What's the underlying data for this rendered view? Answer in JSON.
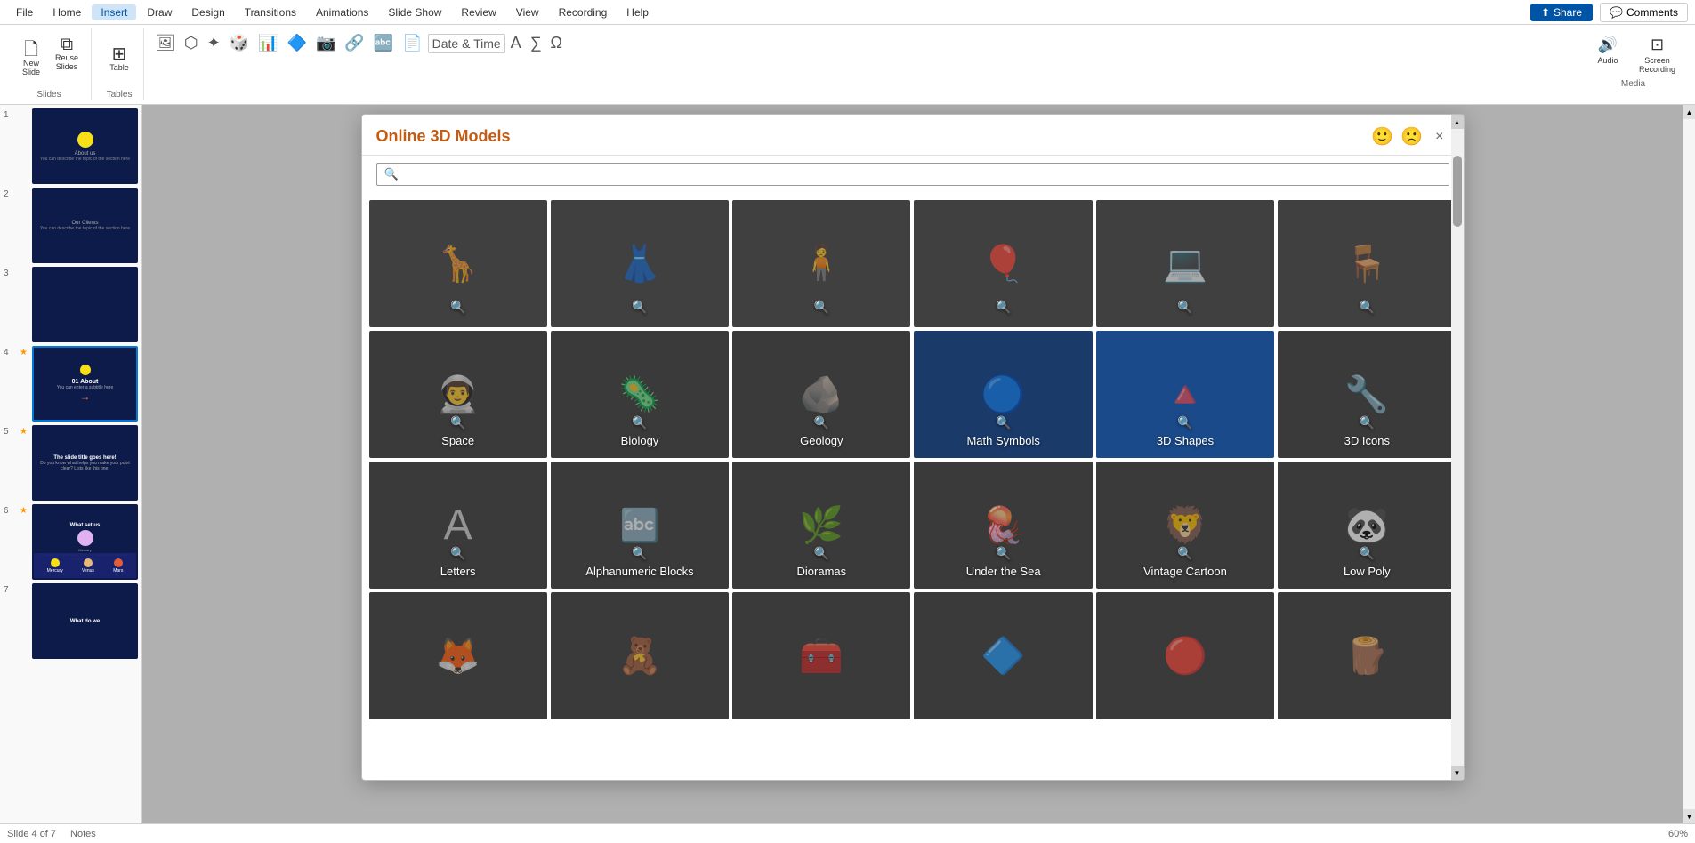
{
  "menubar": {
    "items": [
      "File",
      "Home",
      "Insert",
      "Draw",
      "Design",
      "Transitions",
      "Animations",
      "Slide Show",
      "Review",
      "View",
      "Recording",
      "Help"
    ],
    "active": "Insert",
    "share_label": "Share",
    "comments_label": "Comments"
  },
  "ribbon": {
    "groups": [
      {
        "name": "Slides",
        "items": [
          {
            "label": "New\nSlide",
            "icon": "🗋"
          },
          {
            "label": "Reuse\nSlides",
            "icon": "⧉"
          }
        ]
      },
      {
        "name": "Tables",
        "items": [
          {
            "label": "Table",
            "icon": "⊞"
          }
        ]
      }
    ],
    "media": {
      "label": "Media",
      "items": [
        {
          "label": "Audio",
          "icon": "🔊"
        },
        {
          "label": "Screen\nRecording",
          "icon": "⊡"
        }
      ]
    },
    "date_time_label": "Date & Time"
  },
  "slides": [
    {
      "num": "1",
      "star": false,
      "type": "title",
      "label": "About us"
    },
    {
      "num": "2",
      "star": false,
      "type": "clients",
      "label": "Our Clients"
    },
    {
      "num": "3",
      "star": false,
      "type": "blank"
    },
    {
      "num": "4",
      "star": true,
      "type": "about",
      "label": "01 About",
      "selected": true
    },
    {
      "num": "5",
      "star": true,
      "type": "slide",
      "label": "The slide title goes here!"
    },
    {
      "num": "6",
      "star": true,
      "type": "what",
      "label": "What set us"
    },
    {
      "num": "7",
      "star": false,
      "type": "what2",
      "label": "What do we"
    }
  ],
  "bottom_planets": [
    {
      "label": "Mercury",
      "color": "#f7e017"
    },
    {
      "label": "Venus",
      "color": "#e8b87a"
    },
    {
      "label": "Mars",
      "color": "#e05c3a"
    }
  ],
  "dialog": {
    "title": "Online 3D Models",
    "close_label": "×",
    "search_placeholder": "",
    "positive_emoji": "🙂",
    "negative_emoji": "🙁",
    "categories_row1": [
      {
        "label": "Animals",
        "icon": "🦒",
        "color": "#3a3a3a"
      },
      {
        "label": "Fashion",
        "icon": "👗",
        "color": "#3a3a3a"
      },
      {
        "label": "People",
        "icon": "🧍",
        "color": "#3a3a3a"
      },
      {
        "label": "Balloons",
        "icon": "🎈",
        "color": "#3a3a3a"
      },
      {
        "label": "Laptops",
        "icon": "💻",
        "color": "#3a3a3a"
      },
      {
        "label": "Furniture",
        "icon": "🪑",
        "color": "#3a3a3a"
      }
    ],
    "categories_row2": [
      {
        "label": "Space",
        "icon": "👨‍🚀",
        "color": "#3a3a3a"
      },
      {
        "label": "Biology",
        "icon": "🦠",
        "color": "#3a3a3a"
      },
      {
        "label": "Geology",
        "icon": "🪨",
        "color": "#3a3a3a"
      },
      {
        "label": "Math Symbols",
        "icon": "🔵",
        "color": "#1a3a6a",
        "highlighted": true
      },
      {
        "label": "3D Shapes",
        "icon": "🔺",
        "color": "#1a4a8a"
      },
      {
        "label": "3D Icons",
        "icon": "🔧",
        "color": "#3a3a3a"
      }
    ],
    "categories_row3": [
      {
        "label": "Letters",
        "icon": "🅰",
        "color": "#3a3a3a"
      },
      {
        "label": "Alphanumeric Blocks",
        "icon": "🔤",
        "color": "#3a3a3a"
      },
      {
        "label": "Dioramas",
        "icon": "🌿",
        "color": "#3a3a3a"
      },
      {
        "label": "Under the Sea",
        "icon": "🪼",
        "color": "#3a3a3a"
      },
      {
        "label": "Vintage Cartoon",
        "icon": "🦁",
        "color": "#3a3a3a"
      },
      {
        "label": "Low Poly",
        "icon": "🐼",
        "color": "#3a3a3a"
      }
    ],
    "categories_row4": [
      {
        "label": "",
        "icon": "🦊",
        "color": "#3a3a3a"
      },
      {
        "label": "",
        "icon": "🧸",
        "color": "#3a3a3a"
      },
      {
        "label": "",
        "icon": "🧰",
        "color": "#3a3a3a"
      },
      {
        "label": "",
        "icon": "🔷",
        "color": "#3a3a3a"
      },
      {
        "label": "",
        "icon": "🔴",
        "color": "#3a3a3a"
      },
      {
        "label": "",
        "icon": "🪵",
        "color": "#3a3a3a"
      }
    ]
  },
  "status": {
    "slide_info": "Slide 4 of 7",
    "notes": "Notes",
    "zoom": "60%"
  }
}
